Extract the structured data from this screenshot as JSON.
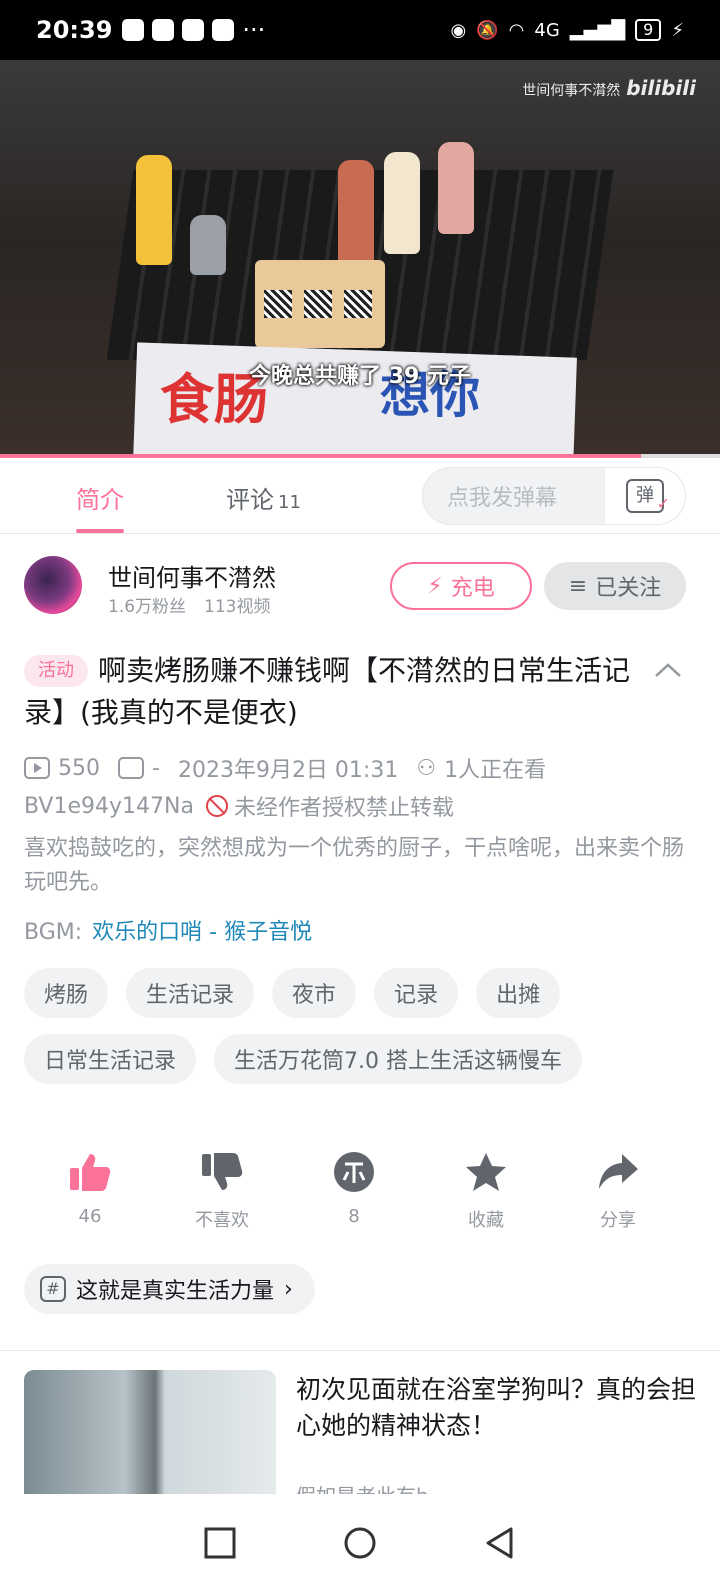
{
  "status_bar": {
    "time": "20:39",
    "battery": "9",
    "network": "4G"
  },
  "video": {
    "watermark_channel": "世间何事不潸然",
    "watermark_logo": "bilibili",
    "subtitle": "今晚总共赚了 39 元子",
    "banner_text_left": "食肠",
    "banner_text_right": "想你",
    "progress": 0.89
  },
  "tabs": {
    "intro": "简介",
    "comments": "评论",
    "comments_count": "11"
  },
  "danmaku": {
    "placeholder": "点我发弹幕",
    "button_glyph": "弹"
  },
  "author": {
    "name": "世间何事不潸然",
    "fans": "1.6万粉丝",
    "videos": "113视频",
    "charge_label": "充电",
    "follow_label": "已关注"
  },
  "video_info": {
    "badge": "活动",
    "title": "啊卖烤肠赚不赚钱啊【不潸然的日常生活记录】(我真的不是便衣)",
    "views": "550",
    "danmaku_count": "-",
    "datetime": "2023年9月2日 01:31",
    "watching": "1人正在看",
    "bvid": "BV1e94y147Na",
    "copyright": "未经作者授权禁止转载",
    "description": "喜欢捣鼓吃的，突然想成为一个优秀的厨子，干点啥呢，出来卖个肠玩吧先。",
    "bgm_label": "BGM:",
    "bgm_song": "欢乐的口哨 - 猴子音悦"
  },
  "tags": [
    "烤肠",
    "生活记录",
    "夜市",
    "记录",
    "出摊",
    "日常生活记录",
    "生活万花筒7.0 搭上生活这辆慢车"
  ],
  "actions": [
    {
      "icon": "thumbs-up-icon",
      "label": "46",
      "color": "#fb7299"
    },
    {
      "icon": "thumbs-down-icon",
      "label": "不喜欢",
      "color": "#61666d"
    },
    {
      "icon": "coin-icon",
      "label": "8",
      "color": "#61666d"
    },
    {
      "icon": "star-icon",
      "label": "收藏",
      "color": "#61666d"
    },
    {
      "icon": "share-icon",
      "label": "分享",
      "color": "#61666d"
    }
  ],
  "topic": {
    "label": "这就是真实生活力量"
  },
  "recommendation": {
    "title": "初次见面就在浴室学狗叫？真的会担心她的精神状态！",
    "subtitle": "假如是老此有b..."
  },
  "colors": {
    "accent": "#fb7299",
    "link": "#1e88b8",
    "muted": "#9499a0"
  }
}
